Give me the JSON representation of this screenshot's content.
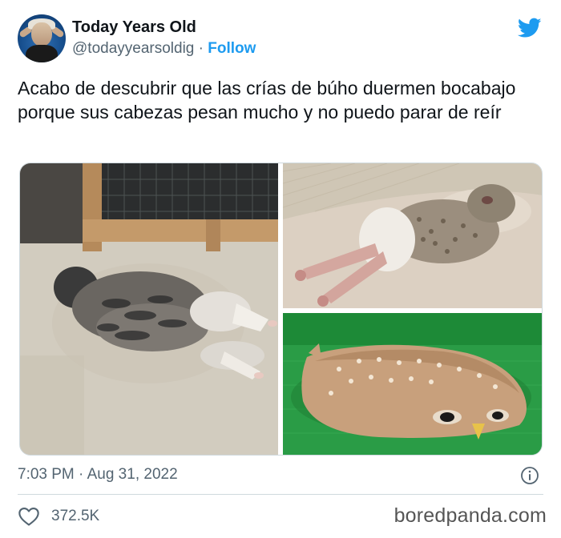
{
  "author": {
    "display_name": "Today Years Old",
    "handle": "@todayyearsoldig",
    "separator": "·",
    "follow_label": "Follow"
  },
  "tweet": {
    "text": "Acabo de descubrir que las crías de búho duermen bocabajo porque sus cabezas pesan mucho y no puedo parar de reír"
  },
  "media": {
    "photos": [
      {
        "name": "owl chick sleeping face down on sand"
      },
      {
        "name": "fluffy owl chick lying flat on blanket"
      },
      {
        "name": "owl lying flat on green turf"
      }
    ]
  },
  "meta": {
    "timestamp": "7:03 PM · Aug 31, 2022",
    "likes": "372.5K"
  },
  "watermark": "boredpanda.com",
  "colors": {
    "accent": "#1d9bf0",
    "secondary_text": "#536471",
    "primary_text": "#0f1419",
    "divider": "#cfd9de"
  },
  "icons": [
    "twitter-bird-icon",
    "info-icon",
    "heart-icon"
  ]
}
